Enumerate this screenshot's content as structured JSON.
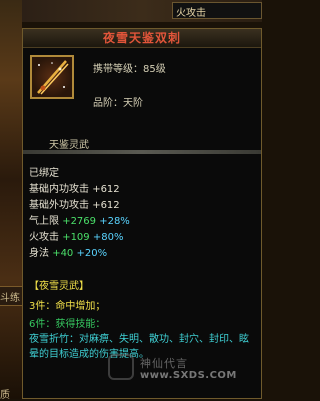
{
  "game": {
    "top_skill_label": "火攻击",
    "left_fragment": "斗练",
    "bottom_left_fragment": "质"
  },
  "tooltip": {
    "title": "夜雪天鉴双刺",
    "level_req": "携带等级：85级",
    "rank": "品阶：天阶",
    "category": "天鉴灵武",
    "bound": "已绑定",
    "stats": [
      {
        "name": "基础内功攻击",
        "base": "+612",
        "plus": "",
        "pct": ""
      },
      {
        "name": "基础外功攻击",
        "base": "+612",
        "plus": "",
        "pct": ""
      },
      {
        "name": "气上限",
        "base": "",
        "plus": "+2769",
        "pct": "+28%"
      },
      {
        "name": "火攻击",
        "base": "",
        "plus": "+109",
        "pct": "+80%"
      },
      {
        "name": "身法",
        "base": "",
        "plus": "+40",
        "pct": "+20%"
      }
    ],
    "set": {
      "name": "【夜雪灵武】",
      "piece3": "3件：命中增加；",
      "piece6": "6件：获得技能：",
      "skill_desc": "夜雪折竹：对麻痹、失明、散功、封穴、封印、眩晕的目标造成的伤害提高。"
    }
  },
  "watermark": {
    "text": "神仙代言",
    "url": "www.SXDS.COM"
  },
  "colors": {
    "title": "#e2553a",
    "green": "#4be06a",
    "cyan": "#5ad4ff",
    "set_yellow": "#f1e04a",
    "set_desc": "#3fd0d4"
  }
}
